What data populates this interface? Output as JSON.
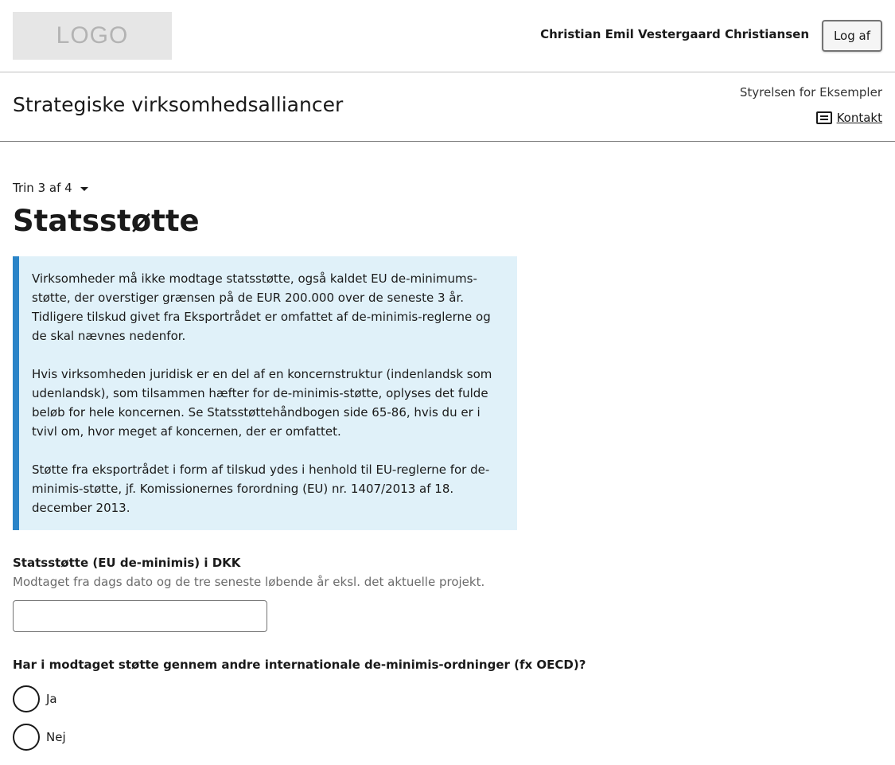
{
  "header": {
    "logo_text": "LOGO",
    "user_name": "Christian Emil Vestergaard Christiansen",
    "logout_label": "Log af"
  },
  "subheader": {
    "service_title": "Strategiske virksomhedsalliancer",
    "authority": "Styrelsen for Eksempler",
    "contact_label": "Kontakt",
    "contact_icon": "message-icon"
  },
  "main": {
    "step_label": "Trin 3 af 4",
    "page_title": "Statsstøtte",
    "info_paragraphs": [
      "Virksomheder må ikke modtage statsstøtte, også kaldet EU de-minimums-støtte, der overstiger grænsen på de EUR 200.000 over de seneste 3 år. Tidligere tilskud givet fra Eksportrådet er omfattet af de-minimis-reglerne og de skal nævnes nedenfor.",
      "Hvis virksomheden juridisk er en del af en koncernstruktur (indenlandsk som udenlandsk), som tilsammen hæfter for de-minimis-støtte, oplyses det fulde beløb for hele koncernen. Se Statsstøttehåndbogen side 65-86, hvis du er i tvivl om, hvor meget af koncernen, der er omfattet.",
      "Støtte fra eksportrådet i form af tilskud ydes i henhold til EU-reglerne for de-minimis-støtte, jf. Komissionernes forordning (EU) nr. 1407/2013 af 18. december 2013."
    ],
    "amount_field": {
      "label": "Statsstøtte (EU de-minimis) i DKK",
      "hint": "Modtaget fra dags dato og de tre seneste løbende år eksl. det aktuelle projekt.",
      "value": ""
    },
    "question": {
      "label": "Har i modtaget støtte gennem andre internationale de-minimis-ordninger (fx OECD)?",
      "options": [
        "Ja",
        "Nej"
      ]
    }
  },
  "colors": {
    "info_background": "#e0f1f9",
    "info_border": "#2a84c8"
  }
}
